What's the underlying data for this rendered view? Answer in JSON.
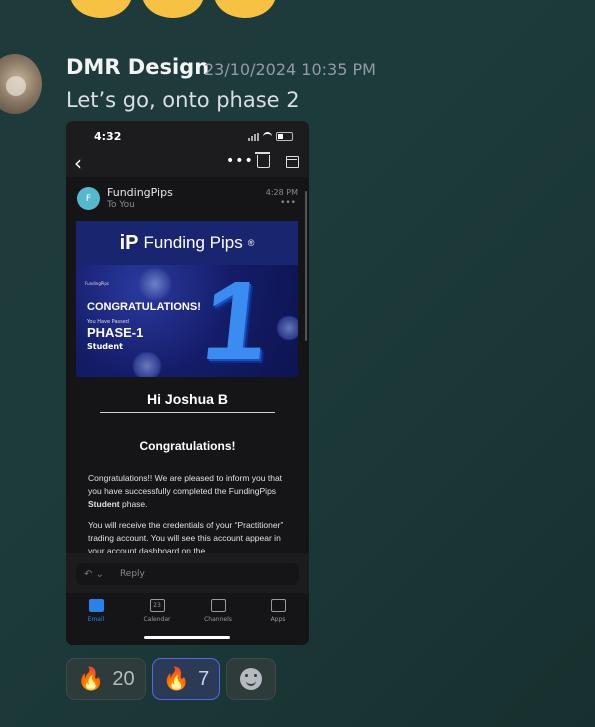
{
  "message": {
    "author": "DMR Design",
    "timestamp": "23/10/2024 10:35 PM",
    "text": "Let’s go, onto phase 2"
  },
  "phone": {
    "status_time": "4:32",
    "email": {
      "sender_initial": "F",
      "sender": "FundingPips",
      "recipient": "To You",
      "time": "4:28 PM",
      "banner": {
        "brand": "Funding Pips",
        "brand_small": "FundingPips",
        "congrats": "CONGRATULATIONS!",
        "passed": "You Have Passed",
        "phase": "PHASE-1",
        "level": "Student",
        "big_number": "1"
      },
      "greeting": "Hi Joshua B",
      "heading": "Congratulations!",
      "para1_a": "Congratulations!! We are pleased to inform you that you have successfully completed the FundingPips ",
      "para1_bold": "Student",
      "para1_b": " phase.",
      "para2": "You will receive the credentials of your “Practitioner” trading account. You will see this account appear in your account dashboard on the"
    },
    "reply_placeholder": "Reply",
    "tabs": [
      {
        "label": "Email",
        "active": true
      },
      {
        "label": "Calendar",
        "active": false,
        "badge": "23"
      },
      {
        "label": "Channels",
        "active": false
      },
      {
        "label": "Apps",
        "active": false
      }
    ]
  },
  "reactions": [
    {
      "emoji": "🔥",
      "count": "20",
      "mine": false
    },
    {
      "emoji": "🔥",
      "count": "7",
      "mine": true
    }
  ]
}
